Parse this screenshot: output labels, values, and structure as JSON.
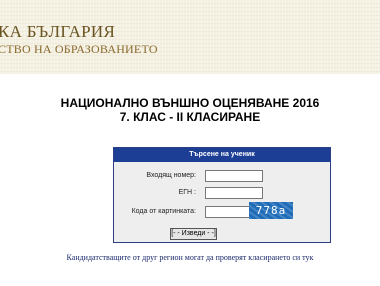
{
  "header": {
    "line1": "КА БЪЛГАРИЯ",
    "line2": "СТВО НА ОБРАЗОВАНИЕТО"
  },
  "page": {
    "title_line1": "НАЦИОНАЛНО ВЪНШНО ОЦЕНЯВАНЕ 2016",
    "title_line2": "7. КЛАС - II КЛАСИРАНЕ"
  },
  "search_panel": {
    "title": "Търсене на ученик",
    "entry_number_label": "Входящ номер:",
    "entry_number_value": "",
    "egn_label": "ЕГН :",
    "egn_value": "",
    "captcha_label": "Кода от картинката:",
    "captcha_value": "",
    "captcha_text": "778a",
    "submit_label": "[- - Изведи - -]"
  },
  "footer": {
    "note": "Кандидатстващите от друг регион могат да проверят класирането си тук"
  },
  "colors": {
    "panel_header_bg": "#1c3f95",
    "captcha_bg": "#1e6bb8",
    "header_text": "#6a5422",
    "footer_link": "#1a2a6c"
  }
}
